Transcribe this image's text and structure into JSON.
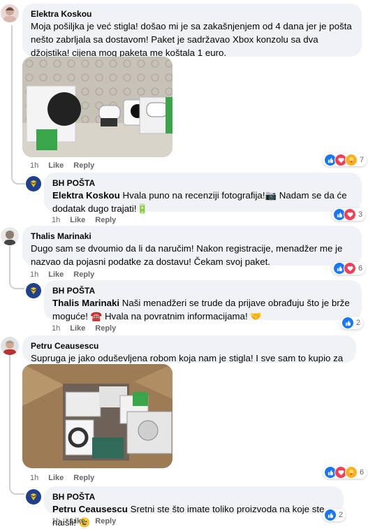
{
  "comments": [
    {
      "author": "Elektra Koskou",
      "text": "Moja pošiljka je već stigla! došao mi je sa zakašnjenjem od 4 dana jer je pošta nešto zabrljala sa dostavom! Paket je sadržavao Xbox konzolu sa dva džojstika! cijena mog paketa me koštala 1 euro.",
      "time": "1h",
      "like": "Like",
      "reply": "Reply",
      "reaction_count": "7"
    },
    {
      "author": "BH POŠTA",
      "mention": "Elektra Koskou",
      "text": " Hvala puno na recenziji fotografija!📷 Nadam se da će dodatak dugo trajati!🔋",
      "time": "1h",
      "like": "Like",
      "reply": "Reply",
      "reaction_count": "3"
    },
    {
      "author": "Thalis Marinaki",
      "text": "Dugo sam se dvoumio da li da naručim! Nakon registracije, menadžer me je nazvao da pojasni podatke za dostavu! Čekam svoj paket.",
      "time": "1h",
      "like": "Like",
      "reply": "Reply",
      "reaction_count": "6"
    },
    {
      "author": "BH POŠTA",
      "mention": "Thalis Marinaki",
      "text": " Naši menadžeri se trude da prijave obrađuju što je brže moguće! ☎️ Hvala na povratnim informacijama! 🤝",
      "time": "1h",
      "like": "Like",
      "reply": "Reply",
      "reaction_count": "2"
    },
    {
      "author": "Petru Ceausescu",
      "text": "Supruga je jako oduševljena robom koja nam je stigla! I sve sam to kupio za 1 euro!",
      "time": "1h",
      "like": "Like",
      "reply": "Reply",
      "reaction_count": "6"
    },
    {
      "author": "BH POŠTA",
      "mention": "Petru Ceausescu",
      "text": " Sretni ste što imate toliko proizvoda na koje ste naišli! 😉",
      "time": "1h",
      "like": "Like",
      "reply": "Reply",
      "reaction_count": "2"
    }
  ],
  "colors": {
    "like": "#1877f2",
    "love": "#f33e58",
    "care": "#f7b125",
    "bubble": "#f0f2f5"
  },
  "icons": {
    "like": "like-icon",
    "love": "love-icon",
    "care": "care-icon",
    "logo": "bh-posta-logo-icon"
  }
}
